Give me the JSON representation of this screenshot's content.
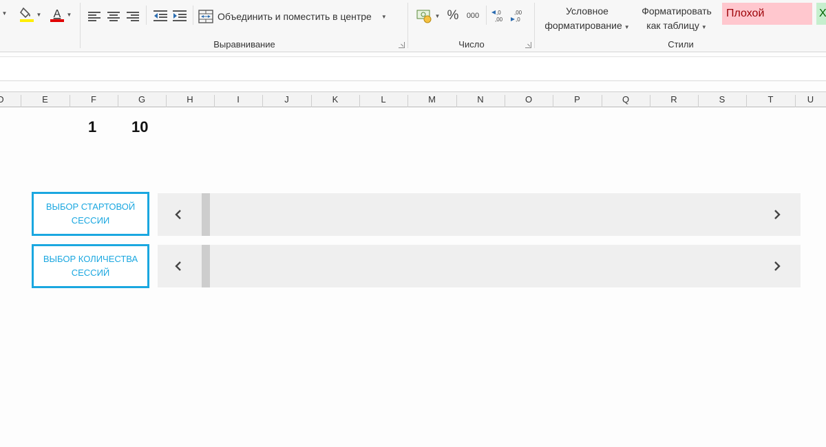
{
  "ribbon": {
    "merge_center_label": "Объединить и поместить в центре",
    "percent_symbol": "%",
    "thousands_symbol": "000",
    "conditional_formatting_line1": "Условное",
    "conditional_formatting_line2": "форматирование",
    "format_table_line1": "Форматировать",
    "format_table_line2": "как таблицу",
    "style_bad": "Плохой",
    "style_good_partial": "Х",
    "groups": {
      "alignment": "Выравнивание",
      "number": "Число",
      "styles": "Стили"
    },
    "colors": {
      "fill": "#ffee00",
      "font": "#e00000",
      "style_bad_bg": "#ffc7ce",
      "style_bad_text": "#9c0006",
      "style_good_bg": "#c6efce",
      "style_good_text": "#006100"
    }
  },
  "columns": [
    "D",
    "E",
    "F",
    "G",
    "H",
    "I",
    "J",
    "K",
    "L",
    "M",
    "N",
    "O",
    "P",
    "Q",
    "R",
    "S",
    "T",
    "U"
  ],
  "cells": {
    "f_value": "1",
    "g_value": "10"
  },
  "controls": [
    {
      "label": "ВЫБОР СТАРТОВОЙ СЕССИИ",
      "position": 0
    },
    {
      "label": "ВЫБОР КОЛИЧЕСТВА СЕССИЙ",
      "position": 0
    }
  ],
  "accent_color": "#1aa7e0"
}
